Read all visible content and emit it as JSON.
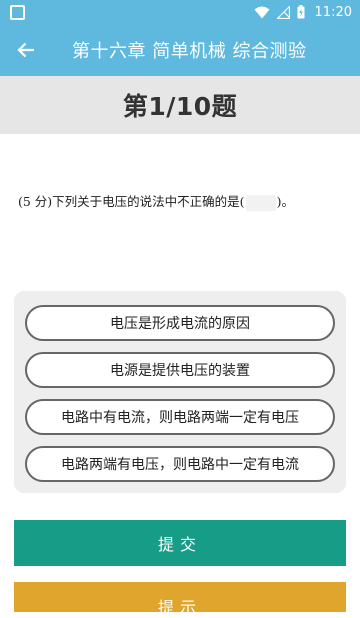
{
  "status_bar": {
    "time": "11:20",
    "icons": [
      "square-icon",
      "wifi-icon",
      "no-signal-icon",
      "battery-icon"
    ]
  },
  "app_bar": {
    "title": "第十六章 简单机械 综合测验",
    "back_icon": "arrow-back-icon"
  },
  "question": {
    "number_label": "第1/10题",
    "text_before_blank": "(5 分)下列关于电压的说法中不正确的是(",
    "text_after_blank": ")。"
  },
  "options": [
    "电压是形成电流的原因",
    "电源是提供电压的装置",
    "电路中有电流，则电路两端一定有电压",
    "电路两端有电压，则电路中一定有电流"
  ],
  "buttons": {
    "submit": "提交",
    "hint": "提示"
  },
  "colors": {
    "app_bar": "#5FB9DF",
    "submit": "#169C87",
    "hint": "#E0A52C",
    "panel": "#EEEEEE"
  }
}
